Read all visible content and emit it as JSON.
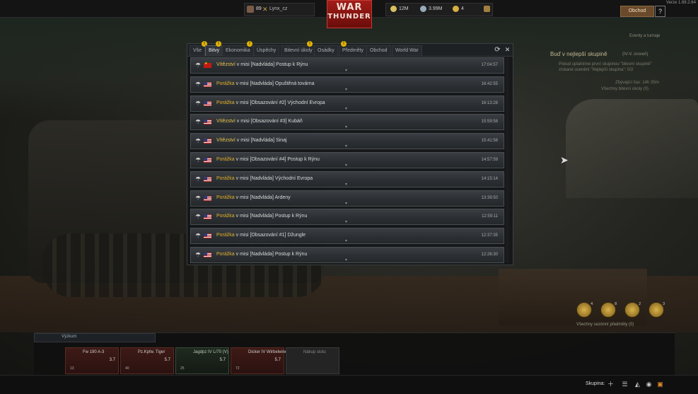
{
  "topbar": {
    "player_level": "89",
    "player_name": "Lynx_cz",
    "logo_line1": "WAR",
    "logo_line2": "THUNDER",
    "silver_lions": "12M",
    "free_rp": "3.99M",
    "golden_eagles": "4",
    "shop_label": "Obchod",
    "help_label": "?",
    "version": "Verze 1.69.2.64"
  },
  "tabs": [
    {
      "label": "Vše",
      "badge": "!"
    },
    {
      "label": "Bitvy",
      "badge": "!",
      "active": true
    },
    {
      "label": "Ekonomika",
      "badge": "!"
    },
    {
      "label": "Úspěchy",
      "badge": ""
    },
    {
      "label": "Bitevní úkoly",
      "badge": "!"
    },
    {
      "label": "Osádky",
      "badge": ""
    },
    {
      "label": "Předměty",
      "badge": "!"
    },
    {
      "label": "Obchod",
      "badge": ""
    },
    {
      "label": "World War",
      "badge": ""
    }
  ],
  "rows": [
    {
      "result": "Vítězství",
      "text": " v misi [Nadvláda] Postup k Rýnu",
      "time": "17:04:57",
      "flag": "cn"
    },
    {
      "result": "Porážka",
      "text": " v misi [Nadvláda] Opuštěná továrna",
      "time": "16:42:55",
      "flag": "us"
    },
    {
      "result": "Porážka",
      "text": " v misi [Obsazování #2] Východní Evropa",
      "time": "16:13:28",
      "flag": "us"
    },
    {
      "result": "Vítězství",
      "text": " v misi [Obsazování #3] Kubáň",
      "time": "15:59:58",
      "flag": "us"
    },
    {
      "result": "Vítězství",
      "text": " v misi [Nadvláda] Sinaj",
      "time": "15:41:58",
      "flag": "us"
    },
    {
      "result": "Porážka",
      "text": " v misi [Obsazování #4] Postup k Rýnu",
      "time": "14:57:59",
      "flag": "us"
    },
    {
      "result": "Porážka",
      "text": " v misi [Nadvláda] Východní Evropa",
      "time": "14:15:14",
      "flag": "us"
    },
    {
      "result": "Porážka",
      "text": " v misi [Nadvláda] Ardeny",
      "time": "13:39:50",
      "flag": "us"
    },
    {
      "result": "Porážka",
      "text": " v misi [Nadvláda] Postup k Rýnu",
      "time": "12:59:11",
      "flag": "us"
    },
    {
      "result": "Porážka",
      "text": " v misi [Obsazování #1] Džungle",
      "time": "12:37:35",
      "flag": "us"
    },
    {
      "result": "Porážka",
      "text": " v misi [Nadvláda] Postup k Rýnu",
      "time": "12:26:30",
      "flag": "us"
    }
  ],
  "side": {
    "events": "Eventy a turnaje",
    "title": "Buď v nejlepší skupině",
    "title_suffix": "(IV-V. úroveň)",
    "desc1": "Pokud uplatníme první skupinou \"bitevní skupině\"",
    "desc2": "získané ocenění \"Nejlepší skupina\": 0/2",
    "time_left": "Zbývající čas: 14h 35m",
    "challenges": "Všechny bitevní úkoly (0)"
  },
  "medals": {
    "counts": [
      "4",
      "8",
      "2",
      "3"
    ],
    "caption": "Všechny sezónní předměty (0)"
  },
  "crew": {
    "header": "Výzkum",
    "slots": [
      {
        "name": "Fw 190 A-3",
        "br": "3.7",
        "count": "13"
      },
      {
        "name": "Pz.Kpfw. Tiger",
        "br": "5.7",
        "count": "40"
      },
      {
        "name": "Jagdpz IV L/70 (V)",
        "br": "5.7",
        "count": "25"
      },
      {
        "name": "Dicker IV Wirbelwind",
        "br": "5.7",
        "count": "72"
      },
      {
        "name": "Nákup slotu",
        "br": "",
        "count": ""
      }
    ]
  },
  "bottom": {
    "squad_label": "Skupina:"
  },
  "colors": {
    "accent": "#e0b02a",
    "logo_red": "#a21d18",
    "win": "#e8c44a"
  }
}
